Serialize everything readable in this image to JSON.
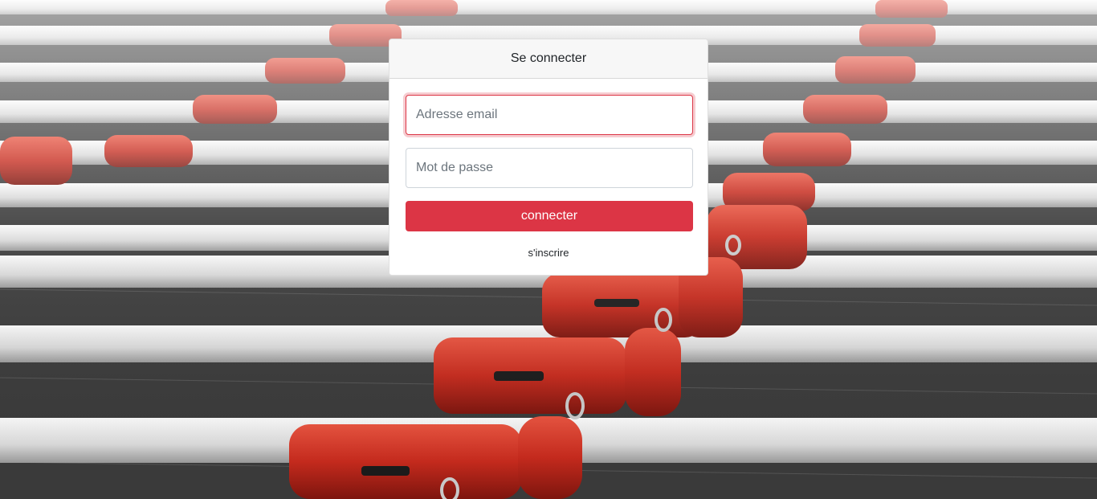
{
  "page": {
    "background_image_description_icon": "shopping-cart-rows-background"
  },
  "login": {
    "title": "Se connecter",
    "email_placeholder": "Adresse email",
    "password_placeholder": "Mot de passe",
    "submit_label": "connecter",
    "signup_label": "s'inscrire"
  },
  "colors": {
    "accent": "#dc3545",
    "header_bg": "#f7f7f7"
  }
}
